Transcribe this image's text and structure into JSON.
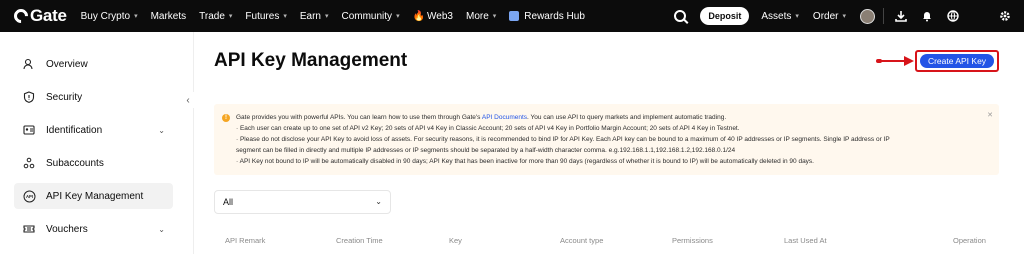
{
  "topnav": {
    "logo_text": "Gate",
    "items": [
      {
        "label": "Buy Crypto",
        "caret": true
      },
      {
        "label": "Markets",
        "caret": false
      },
      {
        "label": "Trade",
        "caret": true
      },
      {
        "label": "Futures",
        "caret": true
      },
      {
        "label": "Earn",
        "caret": true
      },
      {
        "label": "Community",
        "caret": true
      },
      {
        "label": "Web3",
        "caret": false
      },
      {
        "label": "More",
        "caret": true
      },
      {
        "label": "Rewards Hub",
        "caret": false
      }
    ],
    "deposit_label": "Deposit",
    "assets_label": "Assets",
    "order_label": "Order",
    "icons": [
      "search-icon",
      "download-icon",
      "bell-icon",
      "globe-icon",
      "moon-icon",
      "settings-icon"
    ]
  },
  "sidebar": {
    "items": [
      {
        "label": "Overview",
        "icon": "user-icon",
        "active": false,
        "chevron": false
      },
      {
        "label": "Security",
        "icon": "shield-icon",
        "active": false,
        "chevron": false
      },
      {
        "label": "Identification",
        "icon": "id-card-icon",
        "active": false,
        "chevron": true
      },
      {
        "label": "Subaccounts",
        "icon": "subaccounts-icon",
        "active": false,
        "chevron": false
      },
      {
        "label": "API Key Management",
        "icon": "api-icon",
        "active": true,
        "chevron": false
      },
      {
        "label": "Vouchers",
        "icon": "voucher-icon",
        "active": false,
        "chevron": true
      }
    ]
  },
  "main": {
    "title": "API Key Management",
    "create_button": "Create API Key",
    "notice": {
      "line1_pre": "Gate provides you with powerful APIs. You can learn how to use them through Gate's",
      "line1_link": "API Documents",
      "line1_post": ". You can use API to query markets and implement automatic trading.",
      "line2": "· Each user can create up to one set of API v2 Key; 20 sets of API v4 Key in Classic Account; 20 sets of API v4 Key in Portfolio Margin Account; 20 sets of API 4 Key in Testnet.",
      "line3": "· Please do not disclose your API Key to avoid loss of assets. For security reasons, it is recommended to bind IP for API Key. Each API key can be bound to a maximum of 40 IP addresses or IP segments. Single IP address or IP",
      "line4": "segment can be filled in directly and multiple IP addresses or IP segments should be separated by a half-width character comma. e.g.192.168.1.1,192.168.1.2,192.168.0.1/24",
      "line5": "· API Key not bound to IP will be automatically disabled in 90 days; API Key that has been inactive for more than 90 days (regardless of whether it is bound to IP) will be automatically deleted in 90 days."
    },
    "filter_value": "All",
    "table_headers": [
      "API Remark",
      "Creation Time",
      "Key",
      "Account type",
      "Permissions",
      "Last Used At",
      "Operation"
    ]
  }
}
